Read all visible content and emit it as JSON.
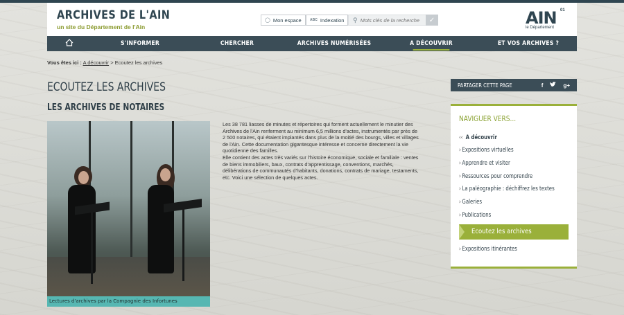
{
  "header": {
    "site_title": "ARCHIVES DE L'AIN",
    "site_subtitle": "un site du Département de l'Ain",
    "btn_espace": "Mon espace",
    "btn_indexation": "Indexation",
    "indexation_badge": "ABC",
    "search_placeholder": "Mots clés de la recherche",
    "brand": "AIN",
    "brand_num": "01",
    "brand_sub": "le Département"
  },
  "nav": {
    "items": [
      "S'INFORMER",
      "CHERCHER",
      "ARCHIVES NUMÉRISÉES",
      "A DÉCOUVRIR",
      "ET VOS ARCHIVES ?"
    ],
    "active": "A DÉCOUVRIR"
  },
  "breadcrumb": {
    "prefix": "Vous êtes ici :",
    "link": "A découvrir",
    "current": "> Ecoutez les archives"
  },
  "main": {
    "title": "ECOUTEZ LES ARCHIVES",
    "subtitle": "LES ARCHIVES DE NOTAIRES",
    "photo_caption": "Lectures d'archives par la Compagnie des Infortunes",
    "paragraph1": "Les 38 781 liasses de minutes et répertoires qui forment actuellement le minutier des Archives de l'Ain renferment au minimum 6,5 millions d'actes, instrumentés par près de 2 500 notaires, qui étaient implantés dans plus de la moitié des bourgs, villes et villages de l'Ain. Cette documentation gigantesque intéresse et concerne directement la vie quotidienne des familles.",
    "paragraph2": "Elle contient des actes très variés sur l'histoire économique, sociale et familiale : ventes de biens immobiliers, baux, contrats d'apprentissage, conventions, marchés, délibérations de communautés d'habitants, donations, contrats de mariage, testaments, etc. Voici une sélection de quelques actes."
  },
  "sidebar": {
    "share_label": "PARTAGER CETTE PAGE",
    "social": [
      "f",
      "t",
      "g+"
    ],
    "nav_title": "NAVIGUER VERS...",
    "parent": "A découvrir",
    "links": [
      "Expositions virtuelles",
      "Apprendre et visiter",
      "Ressources pour comprendre",
      "La paléographie : déchiffrez les textes",
      "Galeries",
      "Publications"
    ],
    "current": "Ecoutez les archives",
    "after": "Expositions itinérantes"
  }
}
